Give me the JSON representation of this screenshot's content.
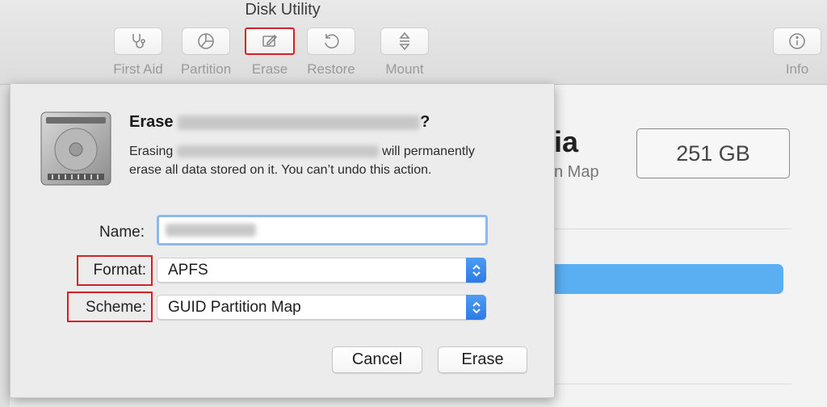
{
  "window": {
    "title": "Disk Utility"
  },
  "toolbar": {
    "first_aid": "First Aid",
    "partition": "Partition",
    "erase": "Erase",
    "restore": "Restore",
    "mount": "Mount",
    "info": "Info"
  },
  "background": {
    "volume_title_fragment": "ia",
    "volume_sub_fragment": "n Map",
    "capacity": "251 GB"
  },
  "dialog": {
    "heading_prefix": "Erase",
    "heading_suffix": "?",
    "desc_prefix": "Erasing",
    "desc_suffix": "will permanently",
    "desc_line2": "erase all data stored on it. You can’t undo this action.",
    "name_label": "Name:",
    "format_label": "Format:",
    "format_value": "APFS",
    "scheme_label": "Scheme:",
    "scheme_value": "GUID Partition Map",
    "cancel": "Cancel",
    "erase": "Erase"
  },
  "colors": {
    "highlight_red": "#d61f26",
    "select_blue": "#2c7ce6",
    "usage_blue": "#5aaef2"
  },
  "icons": [
    "stethoscope-icon",
    "pie-chart-icon",
    "erase-pencil-icon",
    "restore-icon",
    "mount-icon",
    "info-icon",
    "chevron-updown-icon",
    "hard-drive-icon"
  ]
}
